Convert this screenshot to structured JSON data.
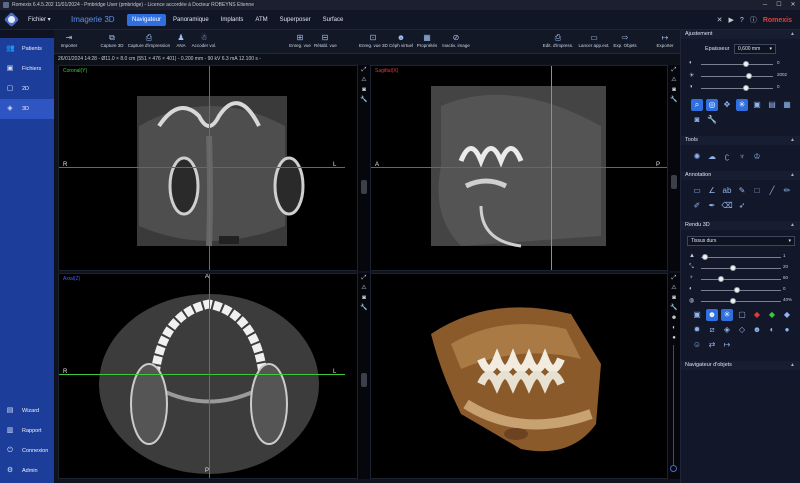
{
  "window": {
    "title": "Romexis 6.4.5.202 11/01/2024 - Pmbridge User (pmbridge) - Licence accordée à Docteur ROBEYNS Etienne"
  },
  "topbar": {
    "menu_label": "Fichier ▾",
    "app_title": "Imagerie 3D",
    "tabs": [
      {
        "label": "Navigateur",
        "active": true
      },
      {
        "label": "Panoramique"
      },
      {
        "label": "Implants"
      },
      {
        "label": "ATM"
      },
      {
        "label": "Superposer"
      },
      {
        "label": "Surface"
      }
    ],
    "brand": "Romexis"
  },
  "sidebar": {
    "items": [
      {
        "label": "Patients"
      },
      {
        "label": "Fichiers"
      },
      {
        "label": "2D"
      },
      {
        "label": "3D",
        "active": true
      }
    ],
    "bottom_items": [
      {
        "label": "Wizard"
      },
      {
        "label": "Rapport"
      },
      {
        "label": "Connexion"
      },
      {
        "label": "Admin"
      }
    ]
  },
  "toolbar": {
    "tools": [
      {
        "label": "Importer"
      },
      {
        "label": "Capture 3D"
      },
      {
        "label": "Capture d'impression"
      },
      {
        "label": "ANA"
      },
      {
        "label": "Accoder vol."
      },
      {
        "label": "Enreg. vue"
      },
      {
        "label": "Rétabl. vue"
      },
      {
        "label": "Enreg. vue 3D"
      },
      {
        "label": "Céph virtuel"
      },
      {
        "label": "Propriétés"
      },
      {
        "label": "Inactiv. image"
      },
      {
        "label": "Edit. d'impress."
      },
      {
        "label": "Lancer app.ext."
      },
      {
        "label": "Exp. Objets"
      },
      {
        "label": "Exporter"
      }
    ]
  },
  "infobar": {
    "text": "26/01/2024 14:28 - Ø11.0 × 8.0 cm (551 × 476 × 401) - 0.200 mm - 90 kV 6.3 mA 12.100 s -"
  },
  "viewports": {
    "coronal": {
      "label": "Coronal(Y)",
      "left": "R",
      "right": "L",
      "color": "#3ec83e"
    },
    "sagittal": {
      "label": "Sagittal(X)",
      "left": "A",
      "right": "P",
      "color": "#e03a3a"
    },
    "axial": {
      "label": "Axial(Z)",
      "top": "A",
      "bottom": "P",
      "left": "R",
      "right": "L",
      "color": "#4a5cf0"
    }
  },
  "rpanel": {
    "ajustement": {
      "title": "Ajustement",
      "thickness_label": "Epaisseur",
      "thickness_value": "0,600 mm",
      "sliders": [
        {
          "icon": "contrast-icon",
          "value": "0",
          "level": 0.62
        },
        {
          "icon": "brightness-icon",
          "value": "2002",
          "level": 0.66
        },
        {
          "icon": "gamma-icon",
          "value": "0",
          "level": 0.62
        }
      ]
    },
    "tools_title": "Tools",
    "annotation_title": "Annotation",
    "rendu": {
      "title": "Rendu 3D",
      "preset": "Tissus durs",
      "sliders": [
        {
          "value": "1",
          "level": 0.05
        },
        {
          "value": "20",
          "level": 0.4
        },
        {
          "value": "60",
          "level": 0.25
        },
        {
          "value": "0",
          "level": 0.45
        },
        {
          "value": "40%",
          "level": 0.4
        }
      ]
    },
    "navigator_title": "Navigateur d'objets"
  }
}
